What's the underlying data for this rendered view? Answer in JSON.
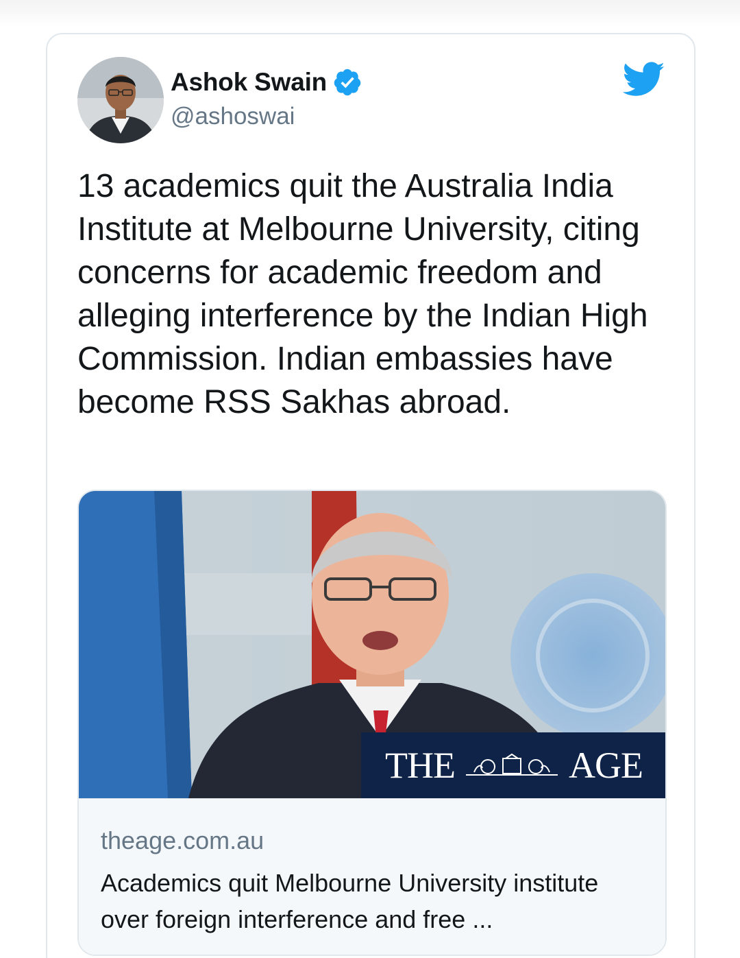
{
  "tweet": {
    "author": {
      "display_name": "Ashok Swain",
      "handle": "@ashoswai",
      "verified": true
    },
    "text": "13 academics quit the Australia India Institute at Melbourne University, citing concerns for academic freedom and alleging interference by the Indian High Commission. Indian embassies have become RSS Sakhas abroad.",
    "link_card": {
      "masthead": {
        "left_word": "THE",
        "right_word": "AGE"
      },
      "domain": "theage.com.au",
      "title": "Academics quit Melbourne University institute over foreign interference and free ..."
    }
  },
  "icons": {
    "brand": "twitter-bird-icon",
    "verified": "verified-badge-icon",
    "masthead_crest": "crest-icon"
  },
  "colors": {
    "twitter_blue": "#1da1f2",
    "text_primary": "#14171a",
    "text_secondary": "#657786",
    "border": "#e1e8ed",
    "masthead_bg": "#0e2347"
  }
}
